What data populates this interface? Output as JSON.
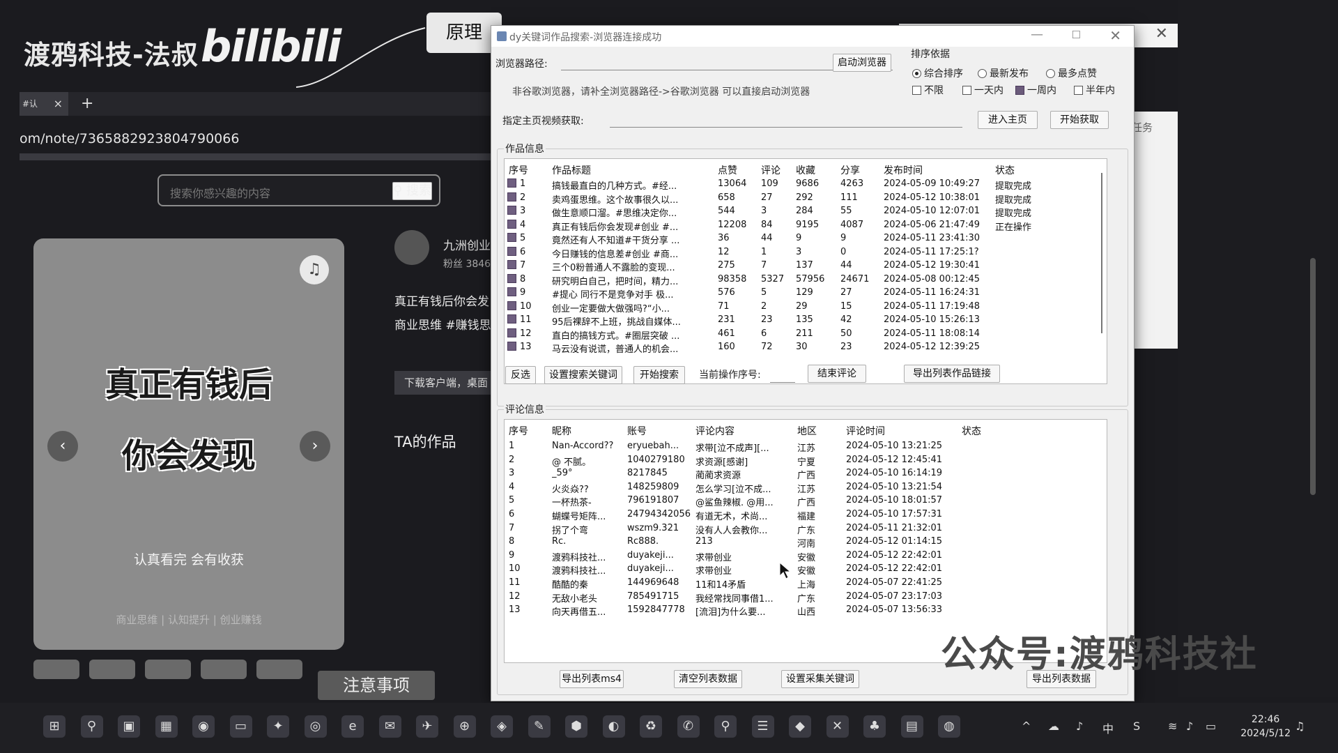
{
  "overlay": {
    "brand": "渡鸦科技-法叔",
    "bili_logo": "bilibili",
    "yuanli_label": "原理",
    "notice_label": "注意事项",
    "watermark": "公众号:渡鸦科技社"
  },
  "browser": {
    "tab_title": "#认",
    "tab_close": "×",
    "new_tab": "+",
    "url": "om/note/7365882923804790066",
    "search_placeholder": "搜索你感兴趣的内容",
    "search_button": "搜索",
    "card_title_1": "真正有钱后",
    "card_title_2": "你会发现",
    "card_sub": "认真看完 会有收获",
    "card_tags": "商业思维 | 认知提升 | 创业赚钱",
    "author_name": "九洲创业",
    "author_fans": "粉丝 3846",
    "desc_line1": "真正有钱后你会发",
    "desc_line2": "商业思维 #赚钱思",
    "download_btn": "下载客户端，桌面",
    "ta_works": "TA的作品",
    "right_panel_text": "任务",
    "colors": {
      "bg": "#1b1b1f",
      "card": "#8c8c8c"
    }
  },
  "window": {
    "title": "dy关键词作品搜索-浏览器连接成功",
    "browser_path_label": "浏览器路径:",
    "launch_browser_btn": "启动浏览器",
    "hint": "非谷歌浏览器，请补全浏览器路径->谷歌浏览器 可以直接启动浏览器",
    "homepage_label": "指定主页视频获取:",
    "enter_home_btn": "进入主页",
    "start_fetch_btn": "开始获取",
    "sort": {
      "title": "排序依据",
      "options": [
        {
          "label": "综合排序",
          "checked": true
        },
        {
          "label": "最新发布",
          "checked": false
        },
        {
          "label": "最多点赞",
          "checked": false
        }
      ],
      "time_filters": [
        {
          "label": "不限",
          "checked": false
        },
        {
          "label": "一天内",
          "checked": false
        },
        {
          "label": "一周内",
          "checked": true
        },
        {
          "label": "半年内",
          "checked": false
        }
      ]
    },
    "works": {
      "group_title": "作品信息",
      "headers": [
        "序号",
        "作品标题",
        "点赞",
        "评论",
        "收藏",
        "分享",
        "发布时间",
        "状态"
      ],
      "rows": [
        [
          "1",
          "搞钱最直白的几种方式。#经...",
          "13064",
          "109",
          "9686",
          "4263",
          "2024-05-09 10:49:27",
          "提取完成"
        ],
        [
          "2",
          "卖鸡蛋思维。这个故事很久以...",
          "658",
          "27",
          "292",
          "111",
          "2024-05-12 10:38:01",
          "提取完成"
        ],
        [
          "3",
          "做生意顺口溜。#思维决定你...",
          "544",
          "3",
          "284",
          "55",
          "2024-05-10 12:07:01",
          "提取完成"
        ],
        [
          "4",
          "真正有钱后你会发现#创业 #...",
          "12208",
          "84",
          "9195",
          "4087",
          "2024-05-06 21:47:49",
          "正在操作"
        ],
        [
          "5",
          "竟然还有人不知道#干货分享 ...",
          "36",
          "44",
          "9",
          "9",
          "2024-05-11 23:41:30",
          ""
        ],
        [
          "6",
          "今日赚钱的信息差#创业 #商...",
          "12",
          "1",
          "3",
          "0",
          "2024-05-11 17:25:1?",
          ""
        ],
        [
          "7",
          "三个0粉普通人不露脸的变现...",
          "275",
          "7",
          "137",
          "44",
          "2024-05-12 19:30:41",
          ""
        ],
        [
          "8",
          "研究明白自己，把时间，精力...",
          "98358",
          "5327",
          "57956",
          "24671",
          "2024-05-08 00:12:45",
          ""
        ],
        [
          "9",
          "#提心 同行不是竞争对手 极...",
          "576",
          "5",
          "129",
          "27",
          "2024-05-11 16:24:31",
          ""
        ],
        [
          "10",
          "创业一定要做大做强吗?“小...",
          "71",
          "2",
          "29",
          "15",
          "2024-05-11 17:19:48",
          ""
        ],
        [
          "11",
          "95后裸辞不上班，挑战自媒体...",
          "231",
          "23",
          "135",
          "42",
          "2024-05-10 15:26:13",
          ""
        ],
        [
          "12",
          "直白的搞钱方式。#圈层突破 ...",
          "461",
          "6",
          "211",
          "50",
          "2024-05-11 18:08:14",
          ""
        ],
        [
          "13",
          "马云没有说谎，普通人的机会...",
          "160",
          "72",
          "30",
          "23",
          "2024-05-12 12:39:25",
          ""
        ]
      ],
      "buttons": {
        "invert": "反选",
        "set_keyword": "设置搜索关键词",
        "start_search": "开始搜索",
        "current_label": "当前操作序号:",
        "end_comment": "结束评论",
        "export_links": "导出列表作品链接"
      }
    },
    "comments": {
      "group_title": "评论信息",
      "headers": [
        "序号",
        "昵称",
        "账号",
        "评论内容",
        "地区",
        "评论时间",
        "状态"
      ],
      "rows": [
        [
          "1",
          "Nan-Accord??",
          "eryuebah...",
          "求带[泣不成声][...",
          "江苏",
          "2024-05-10 13:21:25",
          ""
        ],
        [
          "2",
          "@  不腻。",
          "1040279180",
          "求资源[感谢]",
          "宁夏",
          "2024-05-12 12:45:41",
          ""
        ],
        [
          "3",
          "_59°",
          "8217845",
          "蔺蔺求资源",
          "广西",
          "2024-05-10 16:14:19",
          ""
        ],
        [
          "4",
          "火炎焱??",
          "148259809",
          "怎么学习[泣不成...",
          "江苏",
          "2024-05-10 13:21:54",
          ""
        ],
        [
          "5",
          "一杯热茶-",
          "796191807",
          "@鲨鱼辣椒. @用...",
          "广西",
          "2024-05-10 18:01:57",
          ""
        ],
        [
          "6",
          "蝴蝶号矩阵...",
          "24794342056",
          "有道无术，术尚...",
          "福建",
          "2024-05-10 17:57:31",
          ""
        ],
        [
          "7",
          "拐了个弯",
          "wszm9.321",
          "没有人人会教你...",
          "广东",
          "2024-05-11 21:32:01",
          ""
        ],
        [
          "8",
          "Rc.",
          "Rc888.",
          "213",
          "河南",
          "2024-05-12 01:14:15",
          ""
        ],
        [
          "9",
          "渡鸦科技社...",
          "duyakeji...",
          "求带创业",
          "安徽",
          "2024-05-12 22:42:01",
          ""
        ],
        [
          "10",
          "渡鸦科技社...",
          "duyakeji...",
          "求带创业",
          "安徽",
          "2024-05-12 22:42:01",
          ""
        ],
        [
          "11",
          "酷酷的秦",
          "144969648",
          "11和14矛盾",
          "上海",
          "2024-05-07 22:41:25",
          ""
        ],
        [
          "12",
          "无敌小老头",
          "785491715",
          "我经常找同事借1...",
          "广东",
          "2024-05-07 23:17:03",
          ""
        ],
        [
          "13",
          "向天再借五...",
          "1592847778",
          "[流泪]为什么要...",
          "山西",
          "2024-05-07 13:56:33",
          ""
        ]
      ],
      "buttons": {
        "export_ms4": "导出列表ms4",
        "clear": "清空列表数据",
        "set_collect_kw": "设置采集关键词",
        "export_data": "导出列表数据"
      }
    }
  },
  "taskbar": {
    "icons": [
      "start-icon",
      "search-icon",
      "task-view-icon",
      "store-icon",
      "firefox-icon",
      "folder-icon",
      "app-icon",
      "app-icon",
      "edge-icon",
      "app-icon",
      "app-icon",
      "app-icon",
      "app-icon",
      "app-icon",
      "app-icon",
      "app-icon",
      "app-icon",
      "wechat-icon",
      "app-icon",
      "notes-icon",
      "app-icon",
      "app-icon",
      "app-icon",
      "app-icon",
      "app-icon"
    ],
    "ime": "中",
    "time": "22:46",
    "date": "2024/5/12"
  }
}
